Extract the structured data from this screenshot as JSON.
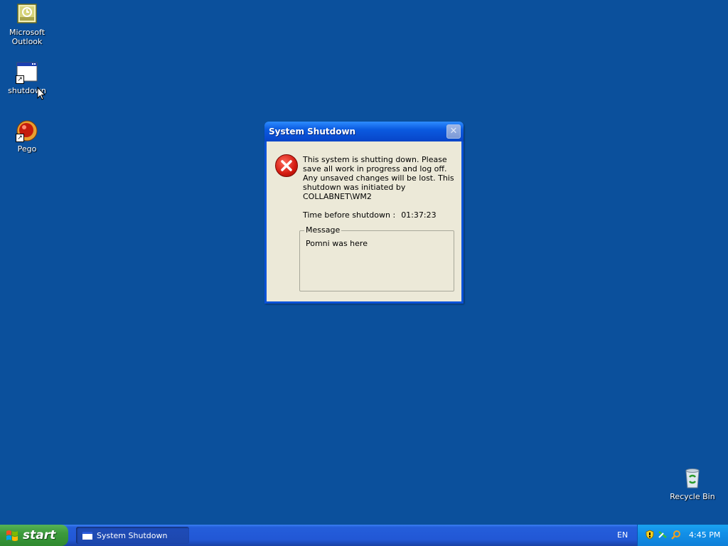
{
  "desktop_icons": [
    {
      "label": "Microsoft Outlook",
      "icon": "outlook-icon"
    },
    {
      "label": "shutdown",
      "icon": "shortcut-window-icon"
    },
    {
      "label": "Pego",
      "icon": "pego-app-icon"
    },
    {
      "label": "Recycle Bin",
      "icon": "recycle-bin-icon"
    }
  ],
  "dialog": {
    "title": "System Shutdown",
    "message": "This system is shutting down. Please save all work in progress and log off. Any unsaved changes will be lost. This shutdown was initiated by COLLABNET\\WM2",
    "timer_label": "Time before shutdown :",
    "timer_value": "01:37:23",
    "group_label": "Message",
    "group_message": "Pomni was here",
    "close_glyph": "✕"
  },
  "taskbar": {
    "start_label": "start",
    "task_label": "System Shutdown",
    "language": "EN",
    "clock": "4:45 PM"
  },
  "colors": {
    "desktop": "#0b509c",
    "dialog_body": "#ece9d8",
    "titlebar": "#0a5ae0",
    "start_button": "#3c9a3c"
  }
}
